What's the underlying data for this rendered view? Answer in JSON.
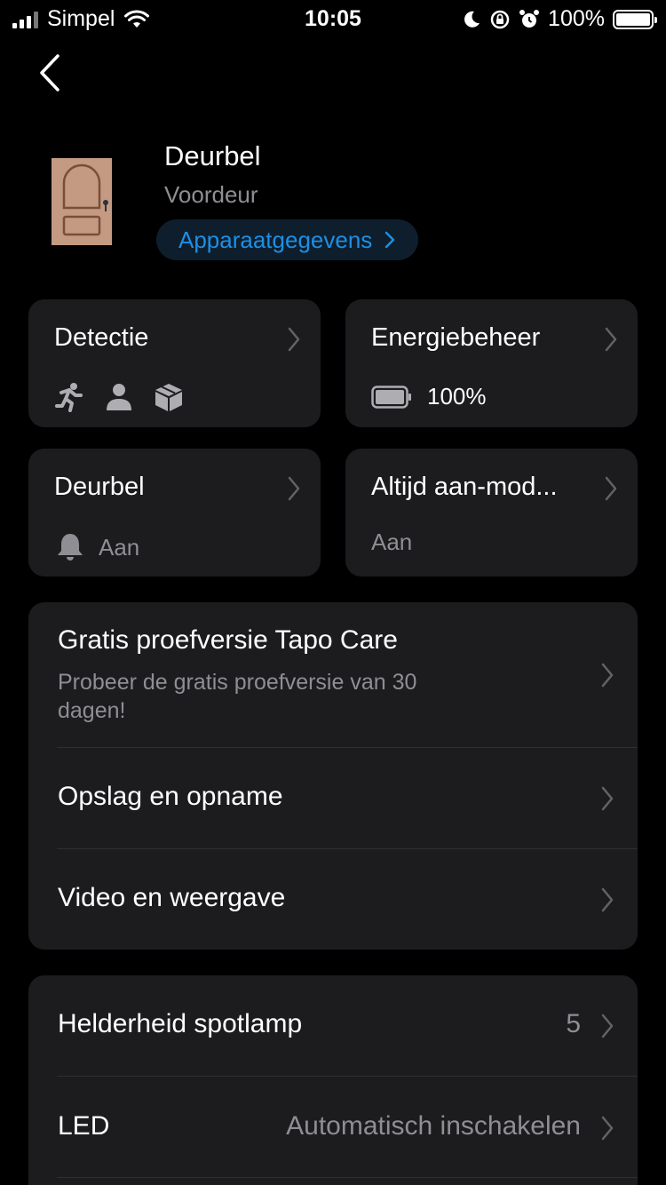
{
  "status_bar": {
    "carrier": "Simpel",
    "time": "10:05",
    "battery_percent": "100%"
  },
  "device": {
    "name": "Deurbel",
    "location": "Voordeur",
    "details_link": "Apparaatgegevens"
  },
  "tiles": {
    "detection": {
      "title": "Detectie",
      "icons": [
        "running-person-icon",
        "person-icon",
        "package-icon"
      ]
    },
    "power": {
      "title": "Energiebeheer",
      "battery_value": "100%"
    },
    "doorbell": {
      "title": "Deurbel",
      "status": "Aan"
    },
    "always_on": {
      "title": "Altijd aan-mod...",
      "status": "Aan"
    }
  },
  "group1": {
    "tapo_care_title": "Gratis proefversie Tapo Care",
    "tapo_care_subtitle": "Probeer de gratis proefversie van 30 dagen!",
    "storage_label": "Opslag en opname",
    "video_label": "Video en weergave"
  },
  "group2": {
    "spotlight_label": "Helderheid spotlamp",
    "spotlight_value": "5",
    "led_label": "LED",
    "led_value": "Automatisch inschakelen"
  },
  "colors": {
    "accent": "#1c8fe6",
    "card_bg": "#1c1c1e",
    "secondary_text": "#8e8e93"
  }
}
